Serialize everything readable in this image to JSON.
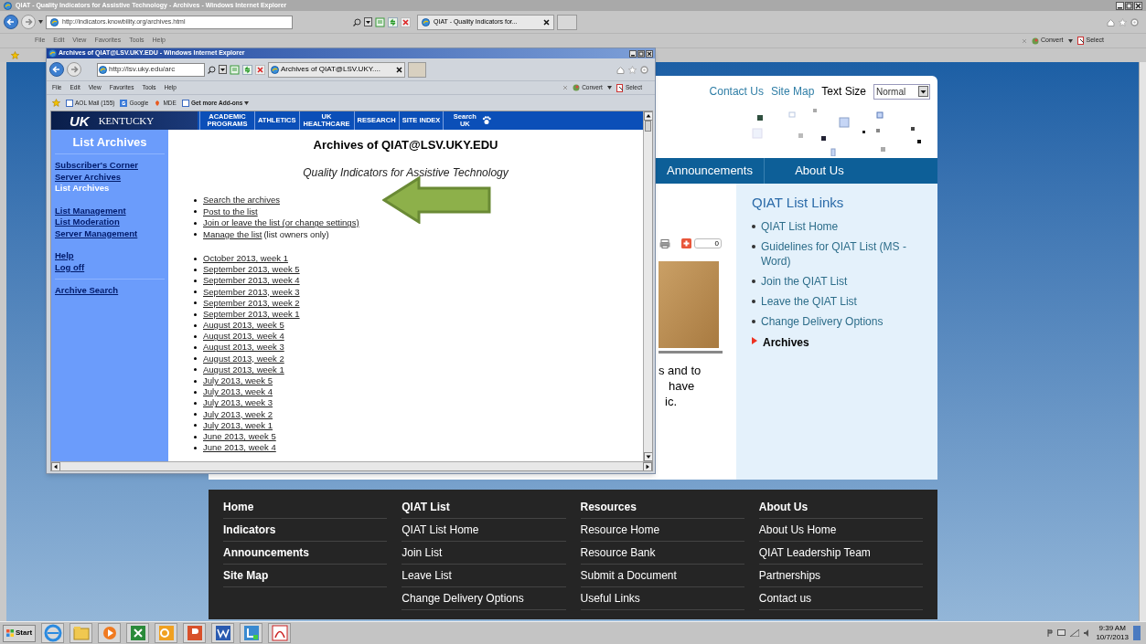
{
  "outer_window": {
    "title": "QIAT - Quality Indicators for Assistive Technology - Archives - Windows Internet Explorer",
    "address": "http://indicators.knowbility.org/archives.html",
    "tab": "QIAT - Quality Indicators for...",
    "menu": [
      "File",
      "Edit",
      "View",
      "Favorites",
      "Tools",
      "Help"
    ],
    "toolbar": [
      "Convert",
      "Select"
    ]
  },
  "page": {
    "header_links": [
      "Contact Us",
      "Site Map"
    ],
    "text_size_label": "Text Size",
    "text_size_value": "Normal",
    "nav": [
      "Announcements",
      "About Us"
    ],
    "share_count": "0",
    "body_fragments": [
      "s and to",
      "have",
      "ic."
    ],
    "sidebar": {
      "title": "QIAT List Links",
      "links": [
        {
          "label": "QIAT List Home",
          "selected": false
        },
        {
          "label": "Guidelines for QIAT List (MS - Word)",
          "selected": false
        },
        {
          "label": "Join the QIAT List",
          "selected": false
        },
        {
          "label": "Leave the QIAT List",
          "selected": false
        },
        {
          "label": "Change Delivery Options",
          "selected": false
        },
        {
          "label": "Archives",
          "selected": true
        }
      ]
    },
    "footer": {
      "columns": [
        {
          "kind": "primary",
          "heading": "Home",
          "links": [
            "Indicators",
            "Announcements",
            "Site Map"
          ]
        },
        {
          "kind": "secondary",
          "heading": "QIAT List",
          "links": [
            "QIAT List Home",
            "Join List",
            "Leave List",
            "Change Delivery Options"
          ]
        },
        {
          "kind": "secondary",
          "heading": "Resources",
          "links": [
            "Resource Home",
            "Resource Bank",
            "Submit a Document",
            "Useful Links"
          ]
        },
        {
          "kind": "secondary",
          "heading": "About Us",
          "links": [
            "About Us Home",
            "QIAT Leadership Team",
            "Partnerships",
            "Contact us"
          ]
        }
      ]
    }
  },
  "inner_window": {
    "title": "Archives of QIAT@LSV.UKY.EDU - Windows Internet Explorer",
    "address": "http://lsv.uky.edu/arc",
    "tab": "Archives of QIAT@LSV.UKY....",
    "menu": [
      "File",
      "Edit",
      "View",
      "Favorites",
      "Tools",
      "Help"
    ],
    "toolbar": [
      "Convert",
      "Select"
    ],
    "favorites": [
      "AOL Mail (155)",
      "Google",
      "MDE",
      "Get more Add-ons"
    ],
    "banner": {
      "logo": "UK",
      "name": "KENTUCKY",
      "nav": [
        "ACADEMIC PROGRAMS",
        "ATHLETICS",
        "UK HEALTHCARE",
        "RESEARCH",
        "SITE INDEX"
      ],
      "search": "Search UK"
    },
    "sidebar": {
      "title": "List Archives",
      "groups": [
        {
          "items": [
            {
              "label": "Subscriber's Corner",
              "selected": false
            },
            {
              "label": "Server Archives",
              "selected": false
            },
            {
              "label": "List Archives",
              "selected": true
            }
          ]
        },
        {
          "items": [
            {
              "label": "List Management",
              "selected": false
            },
            {
              "label": "List Moderation",
              "selected": false
            },
            {
              "label": "Server Management",
              "selected": false
            }
          ]
        },
        {
          "items": [
            {
              "label": "Help",
              "selected": false
            },
            {
              "label": "Log off",
              "selected": false
            }
          ]
        },
        {
          "items": [
            {
              "label": "Archive Search",
              "selected": false
            }
          ]
        }
      ]
    },
    "heading": "Archives of QIAT@LSV.UKY.EDU",
    "subtitle": "Quality Indicators for Assistive Technology",
    "actions": [
      {
        "link": "Search the archives"
      },
      {
        "link": "Post to the list"
      },
      {
        "link": "Join or leave the list (or change settings)"
      },
      {
        "link": "Manage the list",
        "note": "(list owners only)"
      }
    ],
    "weeks": [
      "October 2013, week 1",
      "September 2013, week 5",
      "September 2013, week 4",
      "September 2013, week 3",
      "September 2013, week 2",
      "September 2013, week 1",
      "August 2013, week 5",
      "August 2013, week 4",
      "August 2013, week 3",
      "August 2013, week 2",
      "August 2013, week 1",
      "July 2013, week 5",
      "July 2013, week 4",
      "July 2013, week 3",
      "July 2013, week 2",
      "July 2013, week 1",
      "June 2013, week 5",
      "June 2013, week 4"
    ]
  },
  "taskbar": {
    "start": "Start",
    "time": "9:39 AM",
    "date": "10/7/2013"
  }
}
